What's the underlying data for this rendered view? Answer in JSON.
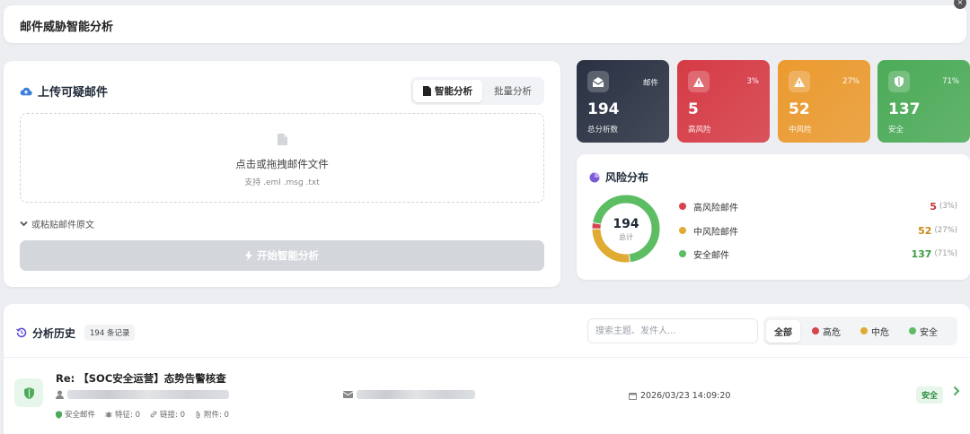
{
  "header": {
    "title": "邮件威胁智能分析"
  },
  "upload": {
    "title": "上传可疑邮件",
    "tabs": [
      {
        "label": "智能分析",
        "active": true
      },
      {
        "label": "批量分析",
        "active": false
      }
    ],
    "dropzone": {
      "main": "点击或拖拽邮件文件",
      "sub": "支持 .eml .msg .txt"
    },
    "paste_toggle": "或粘贴邮件原文",
    "start_button": "开始智能分析"
  },
  "stats": [
    {
      "tag": "邮件",
      "value": "194",
      "label": "总分析数",
      "color": "#2a3142",
      "icon": "envelope-open-icon"
    },
    {
      "tag": "3%",
      "value": "5",
      "label": "高风险",
      "color": "#d63b45",
      "icon": "warning-icon"
    },
    {
      "tag": "27%",
      "value": "52",
      "label": "中风险",
      "color": "#eb9a2e",
      "icon": "warning-icon"
    },
    {
      "tag": "71%",
      "value": "137",
      "label": "安全",
      "color": "#4cab58",
      "icon": "shield-icon"
    }
  ],
  "risk": {
    "title": "风险分布",
    "total": "194",
    "total_label": "总计",
    "items": [
      {
        "name": "高风险邮件",
        "value": "5",
        "pct": "(3%)",
        "color": "#d6454d",
        "share": 0.03
      },
      {
        "name": "中风险邮件",
        "value": "52",
        "pct": "(27%)",
        "color": "#e0ab33",
        "share": 0.27
      },
      {
        "name": "安全邮件",
        "value": "137",
        "pct": "(71%)",
        "color": "#5cbd62",
        "share": 0.71
      }
    ]
  },
  "history": {
    "title": "分析历史",
    "count": "194 条记录",
    "search_placeholder": "搜索主题、发件人...",
    "filters": [
      {
        "label": "全部",
        "active": true,
        "color": ""
      },
      {
        "label": "高危",
        "active": false,
        "color": "#d6454d"
      },
      {
        "label": "中危",
        "active": false,
        "color": "#e0ab33"
      },
      {
        "label": "安全",
        "active": false,
        "color": "#5cbd62"
      }
    ],
    "rows": [
      {
        "subject": "Re: 【SOC安全运营】态势告警核查",
        "datetime": "2026/03/23 14:09:20",
        "meta_status": "安全邮件",
        "meta_features": "特征: 0",
        "meta_links": "链接: 0",
        "meta_attachments": "附件: 0",
        "status": "安全"
      }
    ]
  }
}
